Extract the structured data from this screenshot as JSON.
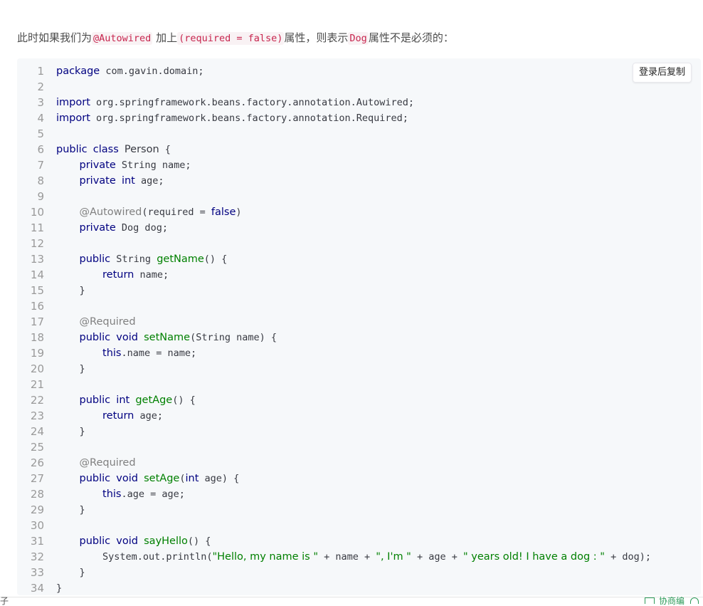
{
  "intro": {
    "before": "此时如果我们为",
    "code1": "@Autowired",
    "mid1": "加上",
    "code2": "(required = false)",
    "mid2": "属性，则表示",
    "code3": "Dog",
    "after": "属性不是必须的："
  },
  "copy_button": "登录后复制",
  "code_lines": [
    [
      [
        "kw",
        "package"
      ],
      [
        "txt",
        " com.gavin.domain;"
      ]
    ],
    [],
    [
      [
        "kw",
        "import"
      ],
      [
        "txt",
        " org.springframework.beans.factory.annotation.Autowired;"
      ]
    ],
    [
      [
        "kw",
        "import"
      ],
      [
        "txt",
        " org.springframework.beans.factory.annotation.Required;"
      ]
    ],
    [],
    [
      [
        "kw",
        "public"
      ],
      [
        "txt",
        " "
      ],
      [
        "kw",
        "class"
      ],
      [
        "txt",
        " "
      ],
      [
        "cls",
        "Person"
      ],
      [
        "txt",
        " {"
      ]
    ],
    [
      [
        "txt",
        "    "
      ],
      [
        "kw",
        "private"
      ],
      [
        "txt",
        " String name;"
      ]
    ],
    [
      [
        "txt",
        "    "
      ],
      [
        "kw",
        "private"
      ],
      [
        "txt",
        " "
      ],
      [
        "kw",
        "int"
      ],
      [
        "txt",
        " age;"
      ]
    ],
    [],
    [
      [
        "txt",
        "    "
      ],
      [
        "ann",
        "@Autowired"
      ],
      [
        "txt",
        "(required = "
      ],
      [
        "kw",
        "false"
      ],
      [
        "txt",
        ")"
      ]
    ],
    [
      [
        "txt",
        "    "
      ],
      [
        "kw",
        "private"
      ],
      [
        "txt",
        " Dog dog;"
      ]
    ],
    [],
    [
      [
        "txt",
        "    "
      ],
      [
        "kw",
        "public"
      ],
      [
        "txt",
        " String "
      ],
      [
        "fn",
        "getName"
      ],
      [
        "txt",
        "() {"
      ]
    ],
    [
      [
        "txt",
        "        "
      ],
      [
        "kw",
        "return"
      ],
      [
        "txt",
        " name;"
      ]
    ],
    [
      [
        "txt",
        "    }"
      ]
    ],
    [],
    [
      [
        "txt",
        "    "
      ],
      [
        "ann",
        "@Required"
      ]
    ],
    [
      [
        "txt",
        "    "
      ],
      [
        "kw",
        "public"
      ],
      [
        "txt",
        " "
      ],
      [
        "kw",
        "void"
      ],
      [
        "txt",
        " "
      ],
      [
        "fn",
        "setName"
      ],
      [
        "txt",
        "(String name) {"
      ]
    ],
    [
      [
        "txt",
        "        "
      ],
      [
        "kw",
        "this"
      ],
      [
        "txt",
        ".name = name;"
      ]
    ],
    [
      [
        "txt",
        "    }"
      ]
    ],
    [],
    [
      [
        "txt",
        "    "
      ],
      [
        "kw",
        "public"
      ],
      [
        "txt",
        " "
      ],
      [
        "kw",
        "int"
      ],
      [
        "txt",
        " "
      ],
      [
        "fn",
        "getAge"
      ],
      [
        "txt",
        "() {"
      ]
    ],
    [
      [
        "txt",
        "        "
      ],
      [
        "kw",
        "return"
      ],
      [
        "txt",
        " age;"
      ]
    ],
    [
      [
        "txt",
        "    }"
      ]
    ],
    [],
    [
      [
        "txt",
        "    "
      ],
      [
        "ann",
        "@Required"
      ]
    ],
    [
      [
        "txt",
        "    "
      ],
      [
        "kw",
        "public"
      ],
      [
        "txt",
        " "
      ],
      [
        "kw",
        "void"
      ],
      [
        "txt",
        " "
      ],
      [
        "fn",
        "setAge"
      ],
      [
        "txt",
        "("
      ],
      [
        "kw",
        "int"
      ],
      [
        "txt",
        " age) {"
      ]
    ],
    [
      [
        "txt",
        "        "
      ],
      [
        "kw",
        "this"
      ],
      [
        "txt",
        ".age = age;"
      ]
    ],
    [
      [
        "txt",
        "    }"
      ]
    ],
    [],
    [
      [
        "txt",
        "    "
      ],
      [
        "kw",
        "public"
      ],
      [
        "txt",
        " "
      ],
      [
        "kw",
        "void"
      ],
      [
        "txt",
        " "
      ],
      [
        "fn",
        "sayHello"
      ],
      [
        "txt",
        "() {"
      ]
    ],
    [
      [
        "txt",
        "        System.out.println("
      ],
      [
        "str",
        "\"Hello, my name is \""
      ],
      [
        "txt",
        " + name + "
      ],
      [
        "str",
        "\", I'm \""
      ],
      [
        "txt",
        " + age + "
      ],
      [
        "str",
        "\" years old! I have a dog : \""
      ],
      [
        "txt",
        " + dog);"
      ]
    ],
    [
      [
        "txt",
        "    }"
      ]
    ],
    [
      [
        "txt",
        "}"
      ]
    ]
  ],
  "colors": {
    "keyword": "#000080",
    "function": "#008000",
    "string": "#008000",
    "annotation": "#808080",
    "code_bg": "#f6f8fa",
    "inline_code": "#c7254e"
  },
  "bottom": {
    "left_text": "子",
    "right_text": "协商编"
  }
}
